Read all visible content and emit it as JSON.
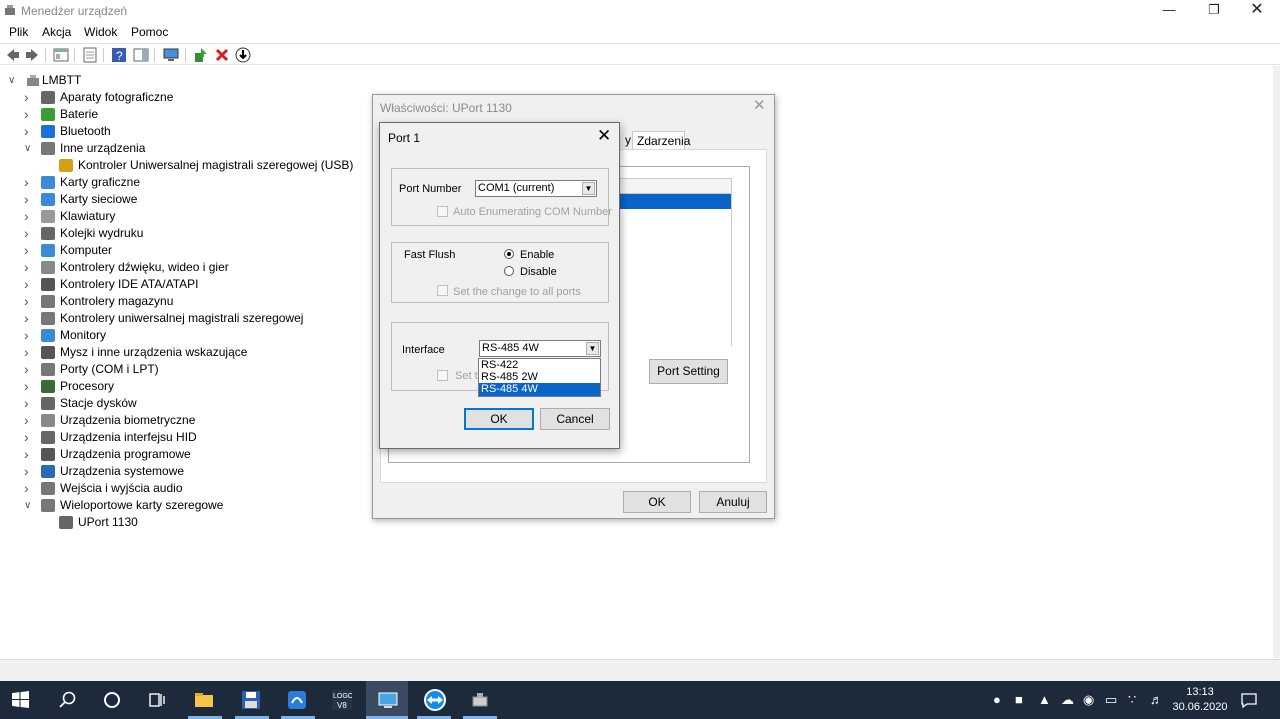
{
  "window": {
    "title": "Menedżer urządzeń"
  },
  "menu": [
    "Plik",
    "Akcja",
    "Widok",
    "Pomoc"
  ],
  "tree": {
    "root": "LMBTT",
    "items": [
      {
        "label": "Aparaty fotograficzne",
        "icon": "camera-icon"
      },
      {
        "label": "Baterie",
        "icon": "battery-icon"
      },
      {
        "label": "Bluetooth",
        "icon": "bluetooth-icon"
      },
      {
        "label": "Inne urządzenia",
        "icon": "other-devices-icon"
      },
      {
        "label": "Kontroler Uniwersalnej magistrali szeregowej (USB)",
        "icon": "warning-device-icon"
      },
      {
        "label": "Karty graficzne",
        "icon": "display-adapter-icon"
      },
      {
        "label": "Karty sieciowe",
        "icon": "network-adapter-icon"
      },
      {
        "label": "Klawiatury",
        "icon": "keyboard-icon"
      },
      {
        "label": "Kolejki wydruku",
        "icon": "printer-icon"
      },
      {
        "label": "Komputer",
        "icon": "computer-icon"
      },
      {
        "label": "Kontrolery dźwięku, wideo i gier",
        "icon": "sound-icon"
      },
      {
        "label": "Kontrolery IDE ATA/ATAPI",
        "icon": "ide-icon"
      },
      {
        "label": "Kontrolery magazynu",
        "icon": "storage-icon"
      },
      {
        "label": "Kontrolery uniwersalnej magistrali szeregowej",
        "icon": "usb-icon"
      },
      {
        "label": "Monitory",
        "icon": "monitor-icon"
      },
      {
        "label": "Mysz i inne urządzenia wskazujące",
        "icon": "mouse-icon"
      },
      {
        "label": "Porty (COM i LPT)",
        "icon": "port-icon"
      },
      {
        "label": "Procesory",
        "icon": "processor-icon"
      },
      {
        "label": "Stacje dysków",
        "icon": "disk-icon"
      },
      {
        "label": "Urządzenia biometryczne",
        "icon": "biometric-icon"
      },
      {
        "label": "Urządzenia interfejsu HID",
        "icon": "hid-icon"
      },
      {
        "label": "Urządzenia programowe",
        "icon": "software-device-icon"
      },
      {
        "label": "Urządzenia systemowe",
        "icon": "system-device-icon"
      },
      {
        "label": "Wejścia i wyjścia audio",
        "icon": "audio-io-icon"
      },
      {
        "label": "Wieloportowe karty szeregowe",
        "icon": "multiport-icon"
      },
      {
        "label": "UPort 1130",
        "icon": "uport-icon"
      }
    ]
  },
  "props": {
    "title": "Właściwości: UPort 1130",
    "tab_partial": "y",
    "tab_events": "Zdarzenia",
    "port_setting": "Port Setting",
    "ok": "OK",
    "cancel": "Anuluj"
  },
  "port": {
    "title": "Port 1",
    "port_number_label": "Port Number",
    "port_number_value": "COM1 (current)",
    "auto_enum": "Auto Enumerating COM Number",
    "fast_flush": "Fast Flush",
    "enable": "Enable",
    "disable": "Disable",
    "set_all": "Set the change to all ports",
    "set_all_partial": "Set t",
    "interface_label": "Interface",
    "interface_value": "RS-485 4W",
    "interface_options": [
      "RS-422",
      "RS-485 2W",
      "RS-485 4W"
    ],
    "ok": "OK",
    "cancel": "Cancel"
  },
  "taskbar": {
    "time": "13:13",
    "date": "30.06.2020"
  }
}
